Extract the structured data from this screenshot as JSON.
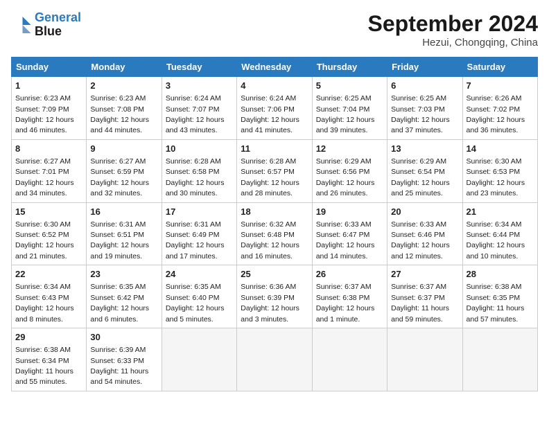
{
  "logo": {
    "line1": "General",
    "line2": "Blue"
  },
  "title": "September 2024",
  "location": "Hezui, Chongqing, China",
  "weekdays": [
    "Sunday",
    "Monday",
    "Tuesday",
    "Wednesday",
    "Thursday",
    "Friday",
    "Saturday"
  ],
  "weeks": [
    [
      {
        "day": 1,
        "sunrise": "6:23 AM",
        "sunset": "7:09 PM",
        "daylight": "12 hours and 46 minutes"
      },
      {
        "day": 2,
        "sunrise": "6:23 AM",
        "sunset": "7:08 PM",
        "daylight": "12 hours and 44 minutes"
      },
      {
        "day": 3,
        "sunrise": "6:24 AM",
        "sunset": "7:07 PM",
        "daylight": "12 hours and 43 minutes"
      },
      {
        "day": 4,
        "sunrise": "6:24 AM",
        "sunset": "7:06 PM",
        "daylight": "12 hours and 41 minutes"
      },
      {
        "day": 5,
        "sunrise": "6:25 AM",
        "sunset": "7:04 PM",
        "daylight": "12 hours and 39 minutes"
      },
      {
        "day": 6,
        "sunrise": "6:25 AM",
        "sunset": "7:03 PM",
        "daylight": "12 hours and 37 minutes"
      },
      {
        "day": 7,
        "sunrise": "6:26 AM",
        "sunset": "7:02 PM",
        "daylight": "12 hours and 36 minutes"
      }
    ],
    [
      {
        "day": 8,
        "sunrise": "6:27 AM",
        "sunset": "7:01 PM",
        "daylight": "12 hours and 34 minutes"
      },
      {
        "day": 9,
        "sunrise": "6:27 AM",
        "sunset": "6:59 PM",
        "daylight": "12 hours and 32 minutes"
      },
      {
        "day": 10,
        "sunrise": "6:28 AM",
        "sunset": "6:58 PM",
        "daylight": "12 hours and 30 minutes"
      },
      {
        "day": 11,
        "sunrise": "6:28 AM",
        "sunset": "6:57 PM",
        "daylight": "12 hours and 28 minutes"
      },
      {
        "day": 12,
        "sunrise": "6:29 AM",
        "sunset": "6:56 PM",
        "daylight": "12 hours and 26 minutes"
      },
      {
        "day": 13,
        "sunrise": "6:29 AM",
        "sunset": "6:54 PM",
        "daylight": "12 hours and 25 minutes"
      },
      {
        "day": 14,
        "sunrise": "6:30 AM",
        "sunset": "6:53 PM",
        "daylight": "12 hours and 23 minutes"
      }
    ],
    [
      {
        "day": 15,
        "sunrise": "6:30 AM",
        "sunset": "6:52 PM",
        "daylight": "12 hours and 21 minutes"
      },
      {
        "day": 16,
        "sunrise": "6:31 AM",
        "sunset": "6:51 PM",
        "daylight": "12 hours and 19 minutes"
      },
      {
        "day": 17,
        "sunrise": "6:31 AM",
        "sunset": "6:49 PM",
        "daylight": "12 hours and 17 minutes"
      },
      {
        "day": 18,
        "sunrise": "6:32 AM",
        "sunset": "6:48 PM",
        "daylight": "12 hours and 16 minutes"
      },
      {
        "day": 19,
        "sunrise": "6:33 AM",
        "sunset": "6:47 PM",
        "daylight": "12 hours and 14 minutes"
      },
      {
        "day": 20,
        "sunrise": "6:33 AM",
        "sunset": "6:46 PM",
        "daylight": "12 hours and 12 minutes"
      },
      {
        "day": 21,
        "sunrise": "6:34 AM",
        "sunset": "6:44 PM",
        "daylight": "12 hours and 10 minutes"
      }
    ],
    [
      {
        "day": 22,
        "sunrise": "6:34 AM",
        "sunset": "6:43 PM",
        "daylight": "12 hours and 8 minutes"
      },
      {
        "day": 23,
        "sunrise": "6:35 AM",
        "sunset": "6:42 PM",
        "daylight": "12 hours and 6 minutes"
      },
      {
        "day": 24,
        "sunrise": "6:35 AM",
        "sunset": "6:40 PM",
        "daylight": "12 hours and 5 minutes"
      },
      {
        "day": 25,
        "sunrise": "6:36 AM",
        "sunset": "6:39 PM",
        "daylight": "12 hours and 3 minutes"
      },
      {
        "day": 26,
        "sunrise": "6:37 AM",
        "sunset": "6:38 PM",
        "daylight": "12 hours and 1 minute"
      },
      {
        "day": 27,
        "sunrise": "6:37 AM",
        "sunset": "6:37 PM",
        "daylight": "11 hours and 59 minutes"
      },
      {
        "day": 28,
        "sunrise": "6:38 AM",
        "sunset": "6:35 PM",
        "daylight": "11 hours and 57 minutes"
      }
    ],
    [
      {
        "day": 29,
        "sunrise": "6:38 AM",
        "sunset": "6:34 PM",
        "daylight": "11 hours and 55 minutes"
      },
      {
        "day": 30,
        "sunrise": "6:39 AM",
        "sunset": "6:33 PM",
        "daylight": "11 hours and 54 minutes"
      },
      null,
      null,
      null,
      null,
      null
    ]
  ]
}
